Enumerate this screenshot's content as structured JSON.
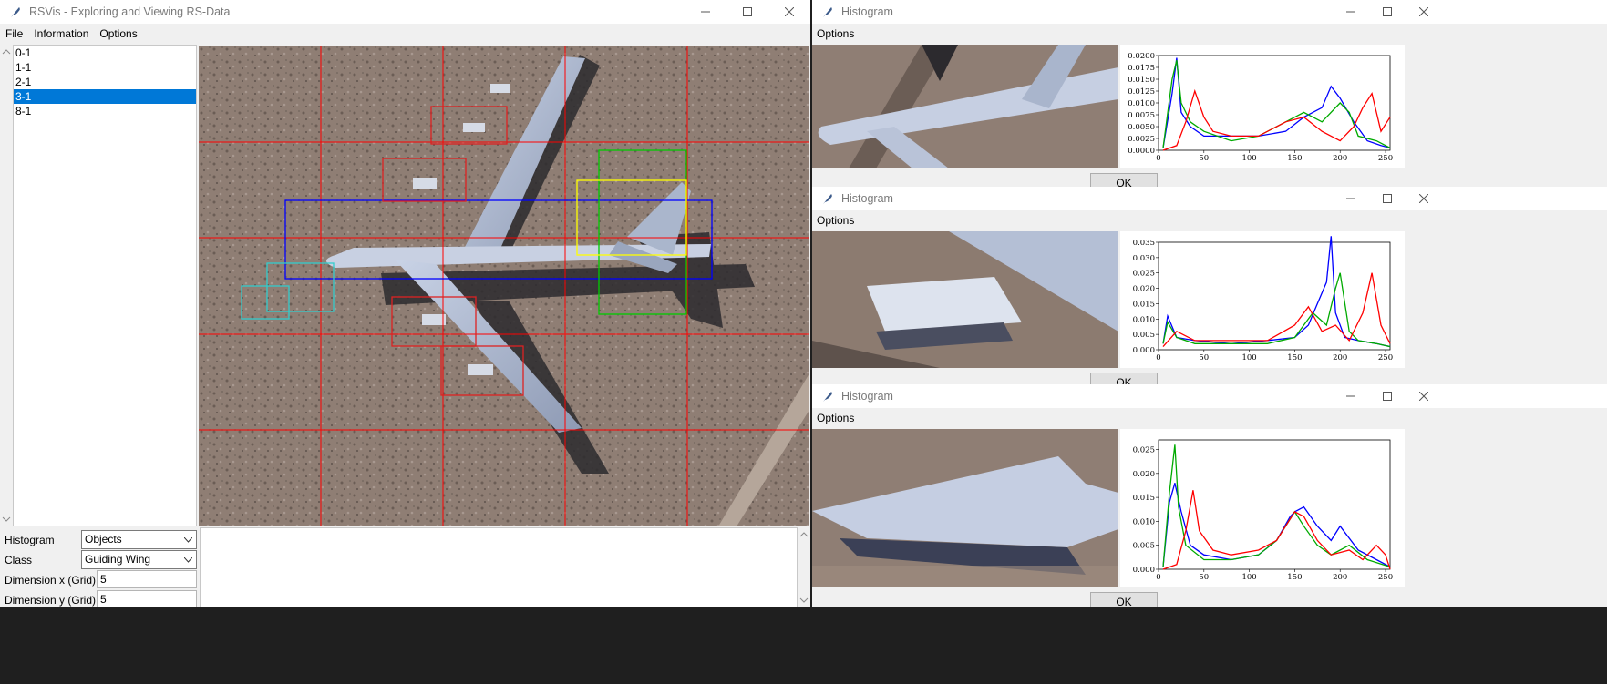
{
  "main": {
    "title": "RSVis - Exploring and Viewing RS-Data",
    "menu": [
      "File",
      "Information",
      "Options"
    ],
    "files": [
      {
        "label": "0-1",
        "selected": false
      },
      {
        "label": "1-1",
        "selected": false
      },
      {
        "label": "2-1",
        "selected": false
      },
      {
        "label": "3-1",
        "selected": true
      },
      {
        "label": "8-1",
        "selected": false
      }
    ],
    "controls": {
      "histogram_label": "Histogram",
      "histogram_value": "Objects",
      "class_label": "Class",
      "class_value": "Guiding Wing",
      "dimx_label": "Dimension x (Grid)",
      "dimx_value": "5",
      "dimy_label": "Dimension y (Grid)",
      "dimy_value": "5"
    },
    "overlay_colors": {
      "grid": "#ff0000",
      "fuselage": "#0000ff",
      "wing": "#00cc00",
      "tail": "#ffff00",
      "engine_small": "#33cccc",
      "engine": "#dd2222"
    }
  },
  "hist_windows": [
    {
      "title": "Histogram",
      "menu": "Options",
      "ok": "OK",
      "yticks": [
        "0.0200",
        "0.0175",
        "0.0150",
        "0.0125",
        "0.0100",
        "0.0075",
        "0.0050",
        "0.0025",
        "0.0000"
      ],
      "xticks": [
        "0",
        "50",
        "100",
        "150",
        "200",
        "250"
      ]
    },
    {
      "title": "Histogram",
      "menu": "Options",
      "ok": "OK",
      "yticks": [
        "0.035",
        "0.030",
        "0.025",
        "0.020",
        "0.015",
        "0.010",
        "0.005",
        "0.000"
      ],
      "xticks": [
        "0",
        "50",
        "100",
        "150",
        "200",
        "250"
      ]
    },
    {
      "title": "Histogram",
      "menu": "Options",
      "ok": "OK",
      "yticks": [
        "0.025",
        "0.020",
        "0.015",
        "0.010",
        "0.005",
        "0.000"
      ],
      "xticks": [
        "0",
        "50",
        "100",
        "150",
        "200",
        "250"
      ]
    }
  ],
  "chart_data": [
    {
      "type": "line",
      "xlim": [
        0,
        255
      ],
      "ylim": [
        0,
        0.02
      ],
      "series": [
        {
          "color": "#0000ff",
          "x": [
            5,
            15,
            20,
            25,
            35,
            50,
            80,
            110,
            140,
            160,
            180,
            190,
            200,
            215,
            230,
            245,
            255
          ],
          "y": [
            0.0005,
            0.012,
            0.0195,
            0.008,
            0.005,
            0.003,
            0.003,
            0.003,
            0.004,
            0.007,
            0.009,
            0.0135,
            0.011,
            0.006,
            0.002,
            0.001,
            0.0005
          ]
        },
        {
          "color": "#00aa00",
          "x": [
            5,
            15,
            20,
            25,
            35,
            50,
            80,
            110,
            140,
            160,
            180,
            200,
            210,
            220,
            240,
            255
          ],
          "y": [
            0.0005,
            0.015,
            0.019,
            0.01,
            0.006,
            0.004,
            0.002,
            0.003,
            0.006,
            0.008,
            0.006,
            0.01,
            0.008,
            0.003,
            0.002,
            0.0005
          ]
        },
        {
          "color": "#ff0000",
          "x": [
            5,
            20,
            30,
            40,
            50,
            60,
            80,
            110,
            140,
            160,
            180,
            200,
            215,
            225,
            235,
            245,
            255
          ],
          "y": [
            0.0,
            0.001,
            0.006,
            0.0125,
            0.007,
            0.004,
            0.003,
            0.003,
            0.006,
            0.007,
            0.004,
            0.002,
            0.005,
            0.009,
            0.012,
            0.004,
            0.007
          ]
        }
      ]
    },
    {
      "type": "line",
      "xlim": [
        0,
        255
      ],
      "ylim": [
        0,
        0.035
      ],
      "series": [
        {
          "color": "#0000ff",
          "x": [
            5,
            10,
            20,
            40,
            80,
            120,
            150,
            165,
            175,
            185,
            190,
            195,
            205,
            220,
            240,
            255
          ],
          "y": [
            0.002,
            0.011,
            0.004,
            0.003,
            0.002,
            0.003,
            0.004,
            0.008,
            0.015,
            0.022,
            0.037,
            0.012,
            0.004,
            0.003,
            0.002,
            0.001
          ]
        },
        {
          "color": "#00aa00",
          "x": [
            5,
            10,
            20,
            40,
            80,
            120,
            150,
            170,
            185,
            195,
            200,
            210,
            220,
            240,
            255
          ],
          "y": [
            0.002,
            0.009,
            0.004,
            0.002,
            0.002,
            0.002,
            0.004,
            0.012,
            0.008,
            0.02,
            0.025,
            0.006,
            0.003,
            0.002,
            0.001
          ]
        },
        {
          "color": "#ff0000",
          "x": [
            5,
            20,
            40,
            80,
            120,
            150,
            165,
            180,
            195,
            210,
            225,
            235,
            245,
            255
          ],
          "y": [
            0.001,
            0.006,
            0.003,
            0.003,
            0.003,
            0.008,
            0.014,
            0.006,
            0.008,
            0.003,
            0.012,
            0.025,
            0.008,
            0.002
          ]
        }
      ]
    },
    {
      "type": "line",
      "xlim": [
        0,
        255
      ],
      "ylim": [
        0,
        0.027
      ],
      "series": [
        {
          "color": "#0000ff",
          "x": [
            5,
            12,
            18,
            25,
            35,
            50,
            80,
            110,
            130,
            145,
            150,
            160,
            175,
            190,
            200,
            220,
            240,
            255
          ],
          "y": [
            0.0005,
            0.014,
            0.018,
            0.012,
            0.005,
            0.003,
            0.002,
            0.003,
            0.006,
            0.011,
            0.012,
            0.013,
            0.009,
            0.006,
            0.009,
            0.004,
            0.002,
            0.0005
          ]
        },
        {
          "color": "#00aa00",
          "x": [
            5,
            12,
            18,
            22,
            30,
            50,
            80,
            110,
            130,
            150,
            160,
            175,
            190,
            210,
            230,
            255
          ],
          "y": [
            0.0005,
            0.016,
            0.026,
            0.013,
            0.005,
            0.002,
            0.002,
            0.003,
            0.006,
            0.012,
            0.009,
            0.005,
            0.003,
            0.005,
            0.002,
            0.0005
          ]
        },
        {
          "color": "#ff0000",
          "x": [
            5,
            20,
            30,
            38,
            45,
            60,
            80,
            110,
            130,
            150,
            160,
            175,
            190,
            210,
            225,
            240,
            250,
            255
          ],
          "y": [
            0.0,
            0.001,
            0.008,
            0.0165,
            0.008,
            0.004,
            0.003,
            0.004,
            0.006,
            0.012,
            0.011,
            0.006,
            0.003,
            0.004,
            0.002,
            0.005,
            0.003,
            0.0
          ]
        }
      ]
    }
  ]
}
